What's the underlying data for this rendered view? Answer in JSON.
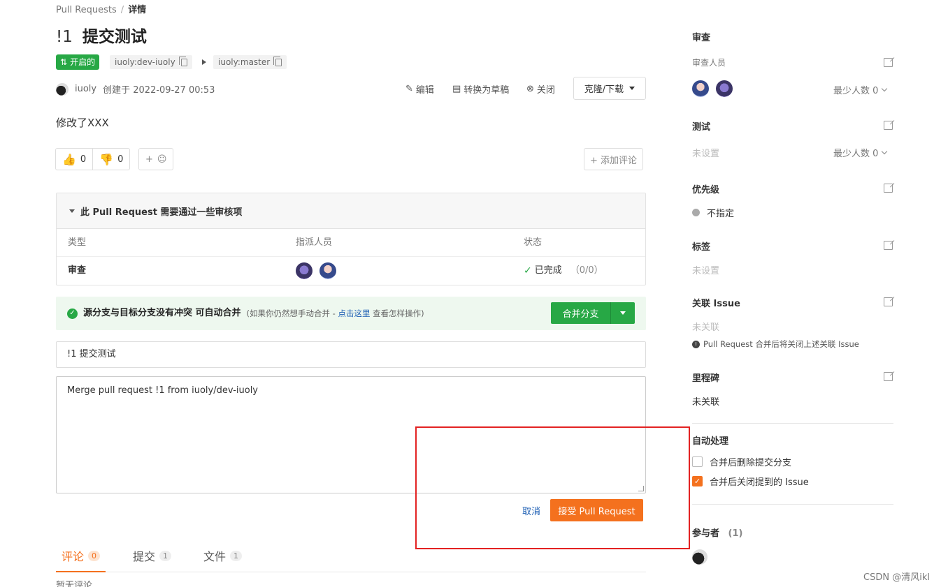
{
  "breadcrumb": {
    "parent": "Pull Requests",
    "separator": "/",
    "current": "详情"
  },
  "pr": {
    "number": "!1",
    "title": "提交测试",
    "status_badge": "开启的",
    "source_branch": "iuoly:dev-iuoly",
    "target_branch": "iuoly:master",
    "author": "iuoly",
    "created": "创建于 2022-09-27 00:53",
    "description": "修改了XXX"
  },
  "toolbar": {
    "edit": "编辑",
    "to_draft": "转换为草稿",
    "close": "关闭",
    "clone": "克隆/下载"
  },
  "reactions": {
    "thumbs_up": "0",
    "thumbs_down": "0",
    "add_emoji": "+",
    "add_comment": "+ 添加评论"
  },
  "review": {
    "heading": "此 Pull Request 需要通过一些审核项",
    "columns": [
      "类型",
      "指派人员",
      "状态"
    ],
    "row": {
      "type": "审查",
      "status": "已完成",
      "progress": "（0/0）"
    }
  },
  "merge": {
    "message": "源分支与目标分支没有冲突 可自动合并",
    "hint_prefix": "(如果你仍然想手动合并 - ",
    "hint_link": "点击这里",
    "hint_suffix": " 查看怎样操作)",
    "button": "合并分支",
    "title_value": "!1 提交测试",
    "body_value": "Merge pull request !1 from iuoly/dev-iuoly",
    "cancel": "取消",
    "accept": "接受 Pull Request"
  },
  "tabs": [
    {
      "label": "评论",
      "count": "0"
    },
    {
      "label": "提交",
      "count": "1"
    },
    {
      "label": "文件",
      "count": "1"
    }
  ],
  "no_comments": "暂无评论",
  "sidebar": {
    "review": {
      "heading": "审查",
      "sub": "审查人员",
      "min": "最少人数 0"
    },
    "test": {
      "heading": "测试",
      "value": "未设置",
      "min": "最少人数 0"
    },
    "priority": {
      "heading": "优先级",
      "value": "不指定"
    },
    "labels": {
      "heading": "标签",
      "value": "未设置"
    },
    "issues": {
      "heading": "关联 Issue",
      "value": "未关联",
      "note": "Pull Request 合并后将关闭上述关联 Issue"
    },
    "milestone": {
      "heading": "里程碑",
      "value": "未关联"
    },
    "auto": {
      "heading": "自动处理",
      "opt1": {
        "label": "合并后删除提交分支",
        "checked": false
      },
      "opt2": {
        "label": "合并后关闭提到的 Issue",
        "checked": true
      }
    },
    "participants": {
      "heading": "参与者",
      "count": "(1)"
    }
  },
  "watermark": "CSDN @清风ikl",
  "colors": {
    "green": "#27a845",
    "orange": "#f4711e",
    "highlight_box": "#e32222",
    "link": "#1d5fb4"
  }
}
